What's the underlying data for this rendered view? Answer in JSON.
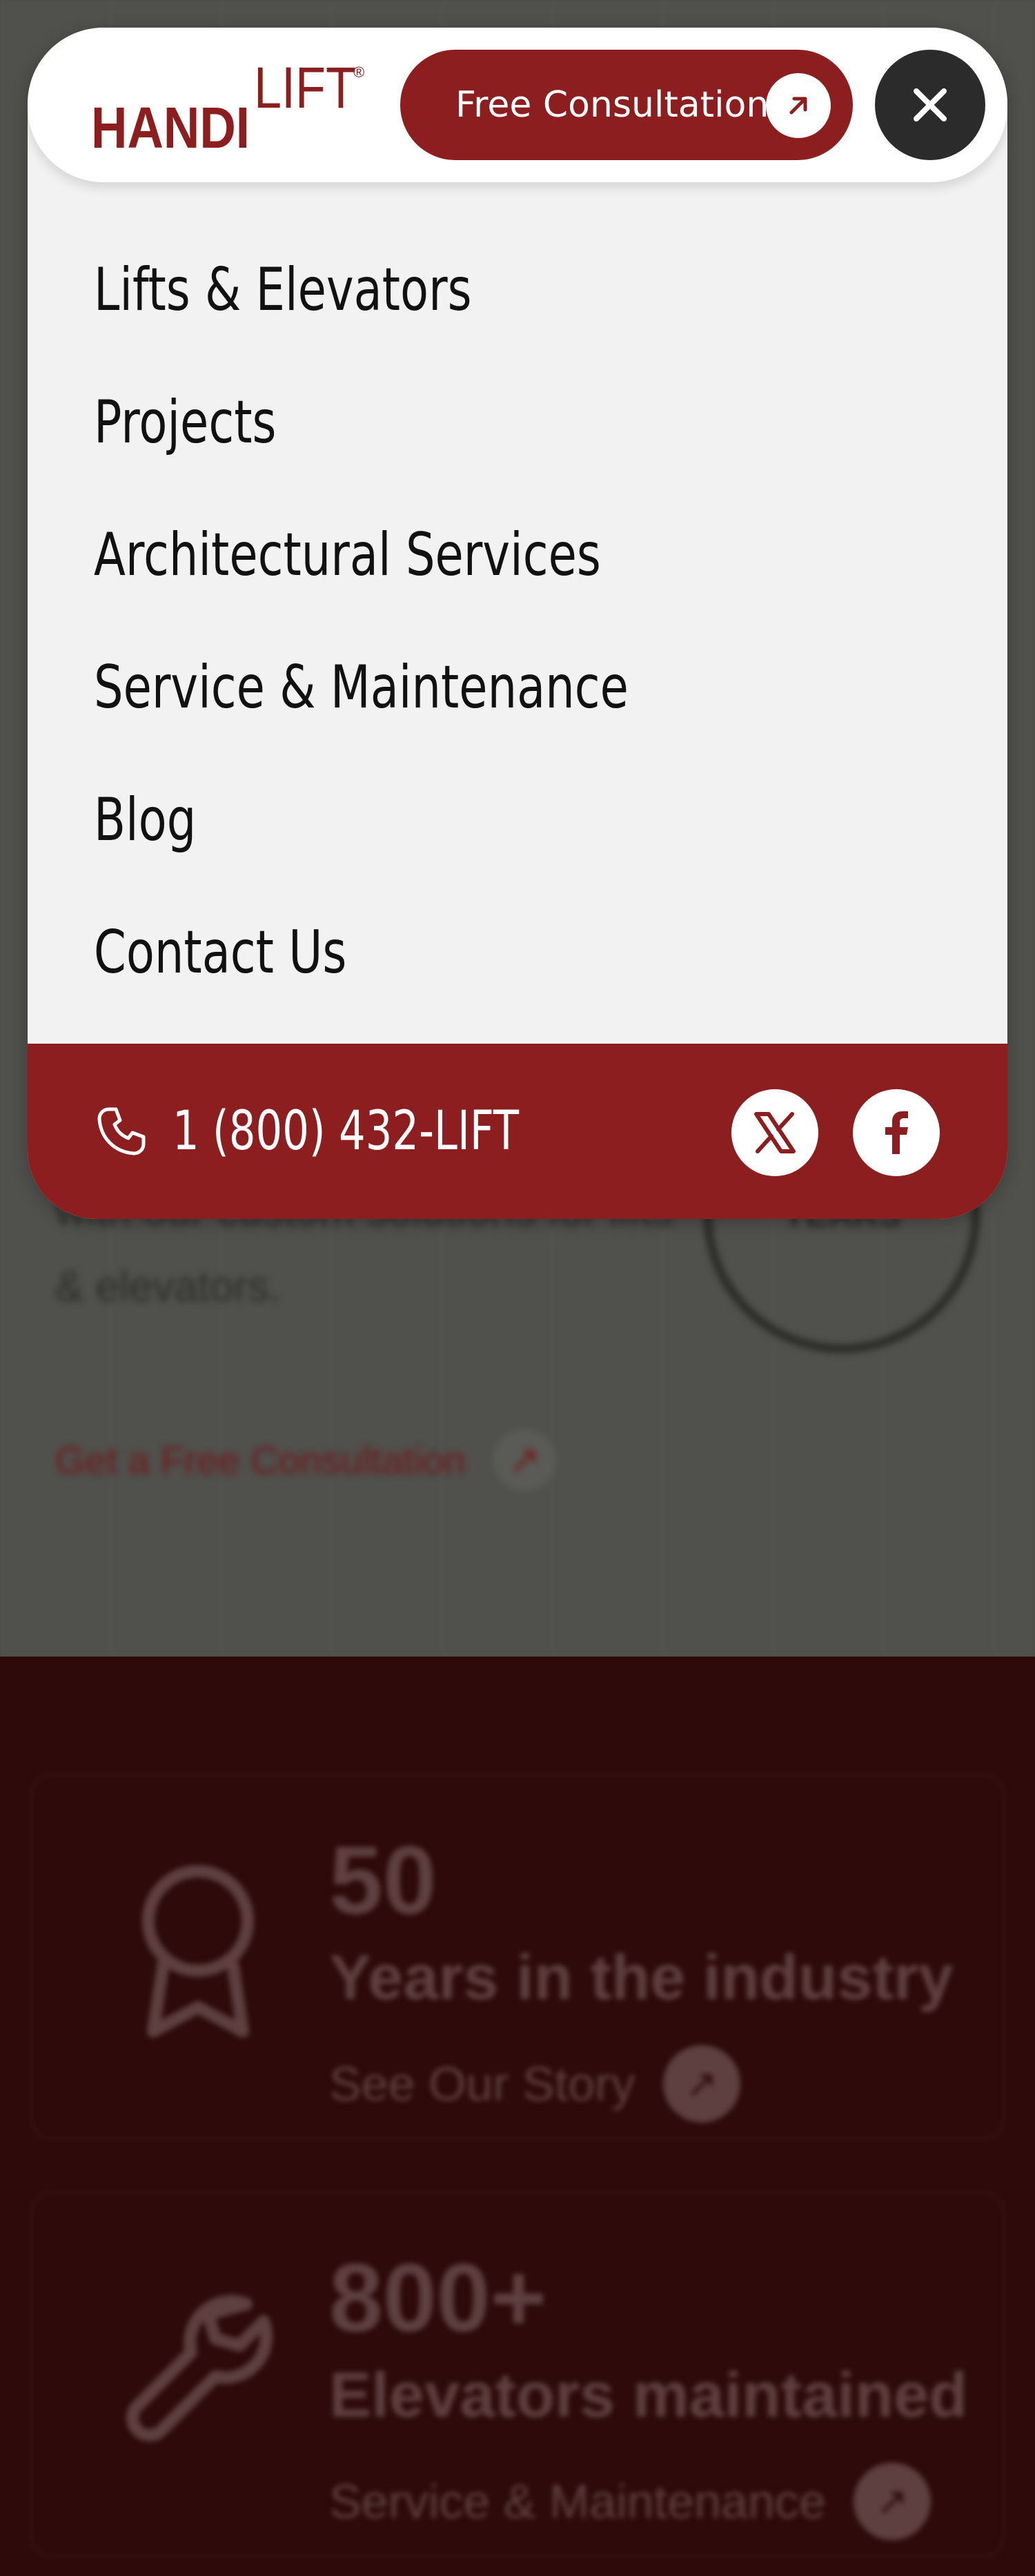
{
  "brand": {
    "logo_handi": "HANDI",
    "logo_lift": "LIFT",
    "logo_reg": "®"
  },
  "header": {
    "cta_label": "Free Consultation",
    "cta_icon": "arrow-up-right-icon",
    "close_icon": "close-icon"
  },
  "nav": {
    "items": [
      {
        "label": "Lifts & Elevators"
      },
      {
        "label": "Projects"
      },
      {
        "label": "Architectural Services"
      },
      {
        "label": "Service & Maintenance"
      },
      {
        "label": "Blog"
      },
      {
        "label": "Contact Us"
      }
    ]
  },
  "footer": {
    "phone": "1 (800) 432-LIFT",
    "phone_icon": "phone-icon",
    "social": [
      {
        "icon": "x-twitter-icon"
      },
      {
        "icon": "facebook-icon"
      }
    ]
  },
  "background": {
    "hero_text": "with our custom solutions for lifts & elevators.",
    "hero_link": "Get a Free Consultation",
    "badge_text": "YEARS",
    "stats": [
      {
        "number": "50",
        "label": "Years in the industry",
        "link": "See Our Story"
      },
      {
        "number": "800+",
        "label": "Elevators maintained",
        "link": "Service & Maintenance"
      }
    ]
  },
  "colors": {
    "brand_red": "#8c1e20",
    "panel_bg": "#f2f2f2",
    "close_bg": "#2b2b2b",
    "overlay": "#4a4a48",
    "stats_bg": "#2e0a0a"
  }
}
